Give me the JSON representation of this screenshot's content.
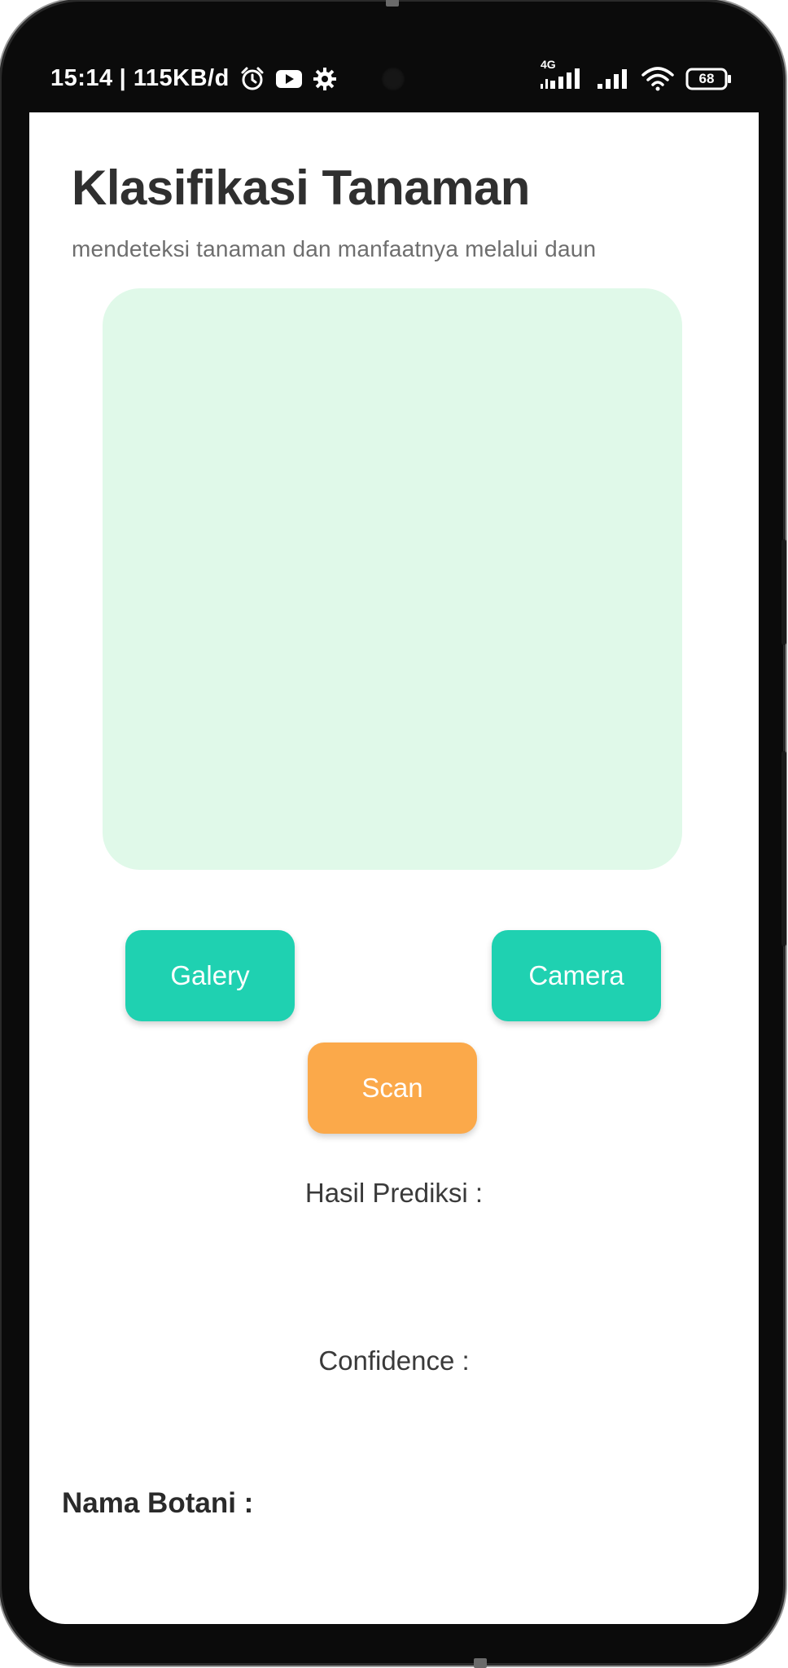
{
  "status_bar": {
    "time": "15:14",
    "network_speed": "| 115KB/d",
    "network_type": "4G",
    "battery": "68",
    "icons": [
      "alarm-icon",
      "youtube-icon",
      "settings-gear-icon",
      "signal-4g-icon",
      "signal-icon",
      "wifi-icon",
      "battery-icon"
    ]
  },
  "header": {
    "title": "Klasifikasi Tanaman",
    "subtitle": "mendeteksi tanaman dan manfaatnya melalui daun"
  },
  "preview": {
    "background_color": "#e0f9e9"
  },
  "actions": {
    "gallery_label": "Galery",
    "camera_label": "Camera",
    "scan_label": "Scan",
    "primary_color": "#1fd1b1",
    "scan_color": "#fba94a"
  },
  "results": {
    "prediction_label": "Hasil Prediksi :",
    "confidence_label": "Confidence :",
    "botanical_name_label": "Nama Botani :"
  }
}
